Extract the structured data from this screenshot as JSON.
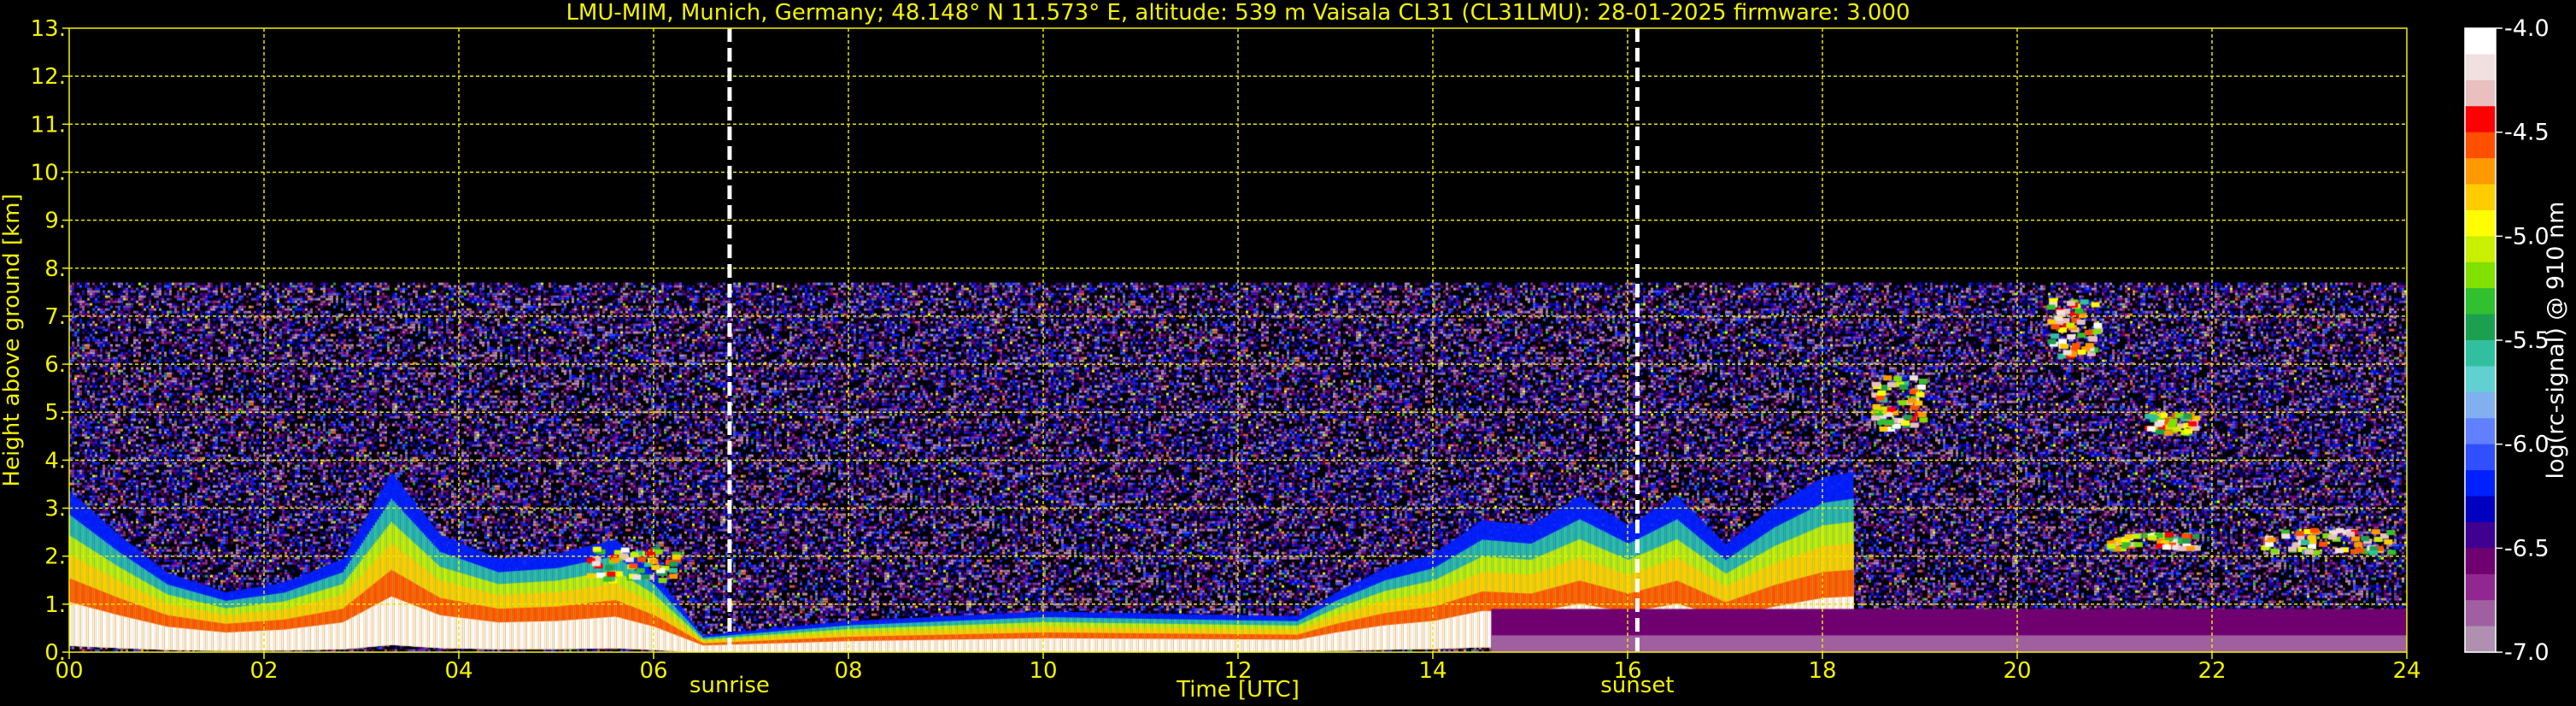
{
  "chart_data": {
    "type": "heatmap",
    "title": "LMU-MIM, Munich, Germany; 48.148° N 11.573° E, altitude: 539 m    Vaisala CL31 (CL31LMU): 28-01-2025    firmware: 3.000",
    "xlabel": "Time [UTC]",
    "ylabel": "Height above ground [km]",
    "xlim": [
      0,
      24
    ],
    "ylim": [
      0,
      13
    ],
    "xticks": [
      "00",
      "02",
      "04",
      "06",
      "08",
      "10",
      "12",
      "14",
      "16",
      "18",
      "20",
      "22",
      "24"
    ],
    "yticks": [
      "0.",
      "1.",
      "2.",
      "3.",
      "4.",
      "5.",
      "6.",
      "7.",
      "8.",
      "9.",
      "10.",
      "11.",
      "12.",
      "13."
    ],
    "grid": true,
    "measurement_max_height_km": 7.7,
    "events": [
      {
        "label": "sunrise",
        "time_h": 6.78
      },
      {
        "label": "sunset",
        "time_h": 16.1
      }
    ],
    "colorbar": {
      "label": "log(rc-signal) @ 910 nm",
      "range": [
        -7.0,
        -4.0
      ],
      "ticks": [
        "-4.0",
        "-4.5",
        "-5.0",
        "-5.5",
        "-6.0",
        "-6.5",
        "-7.0"
      ],
      "colors": [
        "#ffffff",
        "#f0e0e0",
        "#e8c0c0",
        "#ff0000",
        "#ff5000",
        "#ff9900",
        "#ffcc00",
        "#ffff00",
        "#c8f000",
        "#80e000",
        "#30c030",
        "#1ca050",
        "#30c0a0",
        "#60d0d0",
        "#80b0f0",
        "#6080ff",
        "#3050ff",
        "#0020ff",
        "#0000c0",
        "#400090",
        "#700070",
        "#902890",
        "#a060a0",
        "#b090b0"
      ]
    },
    "features": {
      "boundary_layer_height_km": [
        {
          "t": 0.0,
          "h": 3.3
        },
        {
          "t": 0.5,
          "h": 2.4
        },
        {
          "t": 1.0,
          "h": 1.6
        },
        {
          "t": 1.6,
          "h": 1.2
        },
        {
          "t": 2.2,
          "h": 1.4
        },
        {
          "t": 2.8,
          "h": 1.9
        },
        {
          "t": 3.3,
          "h": 3.7
        },
        {
          "t": 3.8,
          "h": 2.4
        },
        {
          "t": 4.4,
          "h": 1.9
        },
        {
          "t": 5.0,
          "h": 2.0
        },
        {
          "t": 5.6,
          "h": 2.3
        },
        {
          "t": 6.0,
          "h": 1.6
        },
        {
          "t": 6.5,
          "h": 0.3
        },
        {
          "t": 8.0,
          "h": 0.6
        },
        {
          "t": 10.0,
          "h": 0.8
        },
        {
          "t": 12.6,
          "h": 0.7
        },
        {
          "t": 13.0,
          "h": 1.2
        },
        {
          "t": 13.5,
          "h": 1.7
        },
        {
          "t": 14.0,
          "h": 2.0
        },
        {
          "t": 14.5,
          "h": 2.7
        },
        {
          "t": 15.0,
          "h": 2.6
        },
        {
          "t": 15.5,
          "h": 3.2
        },
        {
          "t": 16.0,
          "h": 2.6
        },
        {
          "t": 16.5,
          "h": 3.2
        },
        {
          "t": 17.0,
          "h": 2.2
        },
        {
          "t": 17.5,
          "h": 3.0
        },
        {
          "t": 18.0,
          "h": 3.6
        },
        {
          "t": 18.3,
          "h": 3.7
        }
      ],
      "cloud_layers": [
        {
          "t0": 5.3,
          "t1": 6.2,
          "h0": 1.5,
          "h1": 2.2
        },
        {
          "t0": 20.9,
          "t1": 21.8,
          "h0": 2.2,
          "h1": 2.5
        },
        {
          "t0": 22.5,
          "t1": 23.8,
          "h0": 2.1,
          "h1": 2.6
        },
        {
          "t0": 18.5,
          "t1": 19.0,
          "h0": 4.7,
          "h1": 5.8
        },
        {
          "t0": 20.3,
          "t1": 20.8,
          "h0": 6.2,
          "h1": 7.4
        },
        {
          "t0": 21.3,
          "t1": 21.8,
          "h0": 4.6,
          "h1": 5.0
        }
      ]
    }
  }
}
